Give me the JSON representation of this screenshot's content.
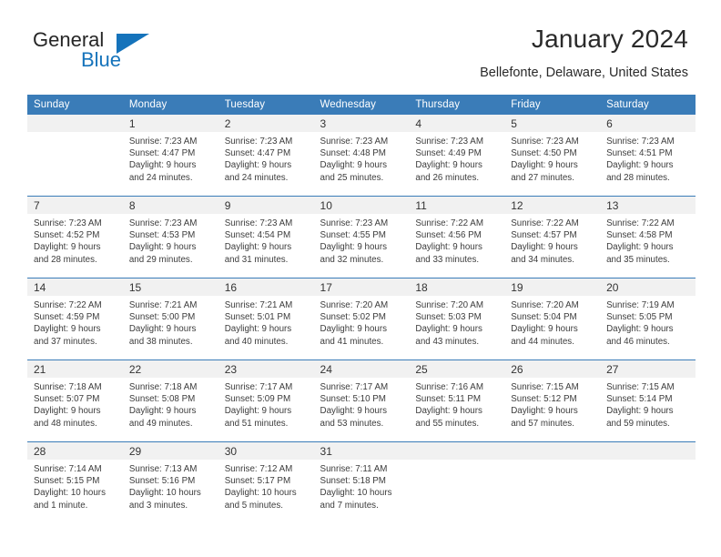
{
  "branding": {
    "word_one": "General",
    "word_two": "Blue"
  },
  "header": {
    "title": "January 2024",
    "location": "Bellefonte, Delaware, United States"
  },
  "calendar": {
    "weekday_headers": [
      "Sunday",
      "Monday",
      "Tuesday",
      "Wednesday",
      "Thursday",
      "Friday",
      "Saturday"
    ],
    "accent_color": "#3a7cb8",
    "daynum_band_color": "#f1f1f1",
    "weeks": [
      [
        {
          "day": "",
          "lines": []
        },
        {
          "day": "1",
          "lines": [
            "Sunrise: 7:23 AM",
            "Sunset: 4:47 PM",
            "Daylight: 9 hours",
            "and 24 minutes."
          ]
        },
        {
          "day": "2",
          "lines": [
            "Sunrise: 7:23 AM",
            "Sunset: 4:47 PM",
            "Daylight: 9 hours",
            "and 24 minutes."
          ]
        },
        {
          "day": "3",
          "lines": [
            "Sunrise: 7:23 AM",
            "Sunset: 4:48 PM",
            "Daylight: 9 hours",
            "and 25 minutes."
          ]
        },
        {
          "day": "4",
          "lines": [
            "Sunrise: 7:23 AM",
            "Sunset: 4:49 PM",
            "Daylight: 9 hours",
            "and 26 minutes."
          ]
        },
        {
          "day": "5",
          "lines": [
            "Sunrise: 7:23 AM",
            "Sunset: 4:50 PM",
            "Daylight: 9 hours",
            "and 27 minutes."
          ]
        },
        {
          "day": "6",
          "lines": [
            "Sunrise: 7:23 AM",
            "Sunset: 4:51 PM",
            "Daylight: 9 hours",
            "and 28 minutes."
          ]
        }
      ],
      [
        {
          "day": "7",
          "lines": [
            "Sunrise: 7:23 AM",
            "Sunset: 4:52 PM",
            "Daylight: 9 hours",
            "and 28 minutes."
          ]
        },
        {
          "day": "8",
          "lines": [
            "Sunrise: 7:23 AM",
            "Sunset: 4:53 PM",
            "Daylight: 9 hours",
            "and 29 minutes."
          ]
        },
        {
          "day": "9",
          "lines": [
            "Sunrise: 7:23 AM",
            "Sunset: 4:54 PM",
            "Daylight: 9 hours",
            "and 31 minutes."
          ]
        },
        {
          "day": "10",
          "lines": [
            "Sunrise: 7:23 AM",
            "Sunset: 4:55 PM",
            "Daylight: 9 hours",
            "and 32 minutes."
          ]
        },
        {
          "day": "11",
          "lines": [
            "Sunrise: 7:22 AM",
            "Sunset: 4:56 PM",
            "Daylight: 9 hours",
            "and 33 minutes."
          ]
        },
        {
          "day": "12",
          "lines": [
            "Sunrise: 7:22 AM",
            "Sunset: 4:57 PM",
            "Daylight: 9 hours",
            "and 34 minutes."
          ]
        },
        {
          "day": "13",
          "lines": [
            "Sunrise: 7:22 AM",
            "Sunset: 4:58 PM",
            "Daylight: 9 hours",
            "and 35 minutes."
          ]
        }
      ],
      [
        {
          "day": "14",
          "lines": [
            "Sunrise: 7:22 AM",
            "Sunset: 4:59 PM",
            "Daylight: 9 hours",
            "and 37 minutes."
          ]
        },
        {
          "day": "15",
          "lines": [
            "Sunrise: 7:21 AM",
            "Sunset: 5:00 PM",
            "Daylight: 9 hours",
            "and 38 minutes."
          ]
        },
        {
          "day": "16",
          "lines": [
            "Sunrise: 7:21 AM",
            "Sunset: 5:01 PM",
            "Daylight: 9 hours",
            "and 40 minutes."
          ]
        },
        {
          "day": "17",
          "lines": [
            "Sunrise: 7:20 AM",
            "Sunset: 5:02 PM",
            "Daylight: 9 hours",
            "and 41 minutes."
          ]
        },
        {
          "day": "18",
          "lines": [
            "Sunrise: 7:20 AM",
            "Sunset: 5:03 PM",
            "Daylight: 9 hours",
            "and 43 minutes."
          ]
        },
        {
          "day": "19",
          "lines": [
            "Sunrise: 7:20 AM",
            "Sunset: 5:04 PM",
            "Daylight: 9 hours",
            "and 44 minutes."
          ]
        },
        {
          "day": "20",
          "lines": [
            "Sunrise: 7:19 AM",
            "Sunset: 5:05 PM",
            "Daylight: 9 hours",
            "and 46 minutes."
          ]
        }
      ],
      [
        {
          "day": "21",
          "lines": [
            "Sunrise: 7:18 AM",
            "Sunset: 5:07 PM",
            "Daylight: 9 hours",
            "and 48 minutes."
          ]
        },
        {
          "day": "22",
          "lines": [
            "Sunrise: 7:18 AM",
            "Sunset: 5:08 PM",
            "Daylight: 9 hours",
            "and 49 minutes."
          ]
        },
        {
          "day": "23",
          "lines": [
            "Sunrise: 7:17 AM",
            "Sunset: 5:09 PM",
            "Daylight: 9 hours",
            "and 51 minutes."
          ]
        },
        {
          "day": "24",
          "lines": [
            "Sunrise: 7:17 AM",
            "Sunset: 5:10 PM",
            "Daylight: 9 hours",
            "and 53 minutes."
          ]
        },
        {
          "day": "25",
          "lines": [
            "Sunrise: 7:16 AM",
            "Sunset: 5:11 PM",
            "Daylight: 9 hours",
            "and 55 minutes."
          ]
        },
        {
          "day": "26",
          "lines": [
            "Sunrise: 7:15 AM",
            "Sunset: 5:12 PM",
            "Daylight: 9 hours",
            "and 57 minutes."
          ]
        },
        {
          "day": "27",
          "lines": [
            "Sunrise: 7:15 AM",
            "Sunset: 5:14 PM",
            "Daylight: 9 hours",
            "and 59 minutes."
          ]
        }
      ],
      [
        {
          "day": "28",
          "lines": [
            "Sunrise: 7:14 AM",
            "Sunset: 5:15 PM",
            "Daylight: 10 hours",
            "and 1 minute."
          ]
        },
        {
          "day": "29",
          "lines": [
            "Sunrise: 7:13 AM",
            "Sunset: 5:16 PM",
            "Daylight: 10 hours",
            "and 3 minutes."
          ]
        },
        {
          "day": "30",
          "lines": [
            "Sunrise: 7:12 AM",
            "Sunset: 5:17 PM",
            "Daylight: 10 hours",
            "and 5 minutes."
          ]
        },
        {
          "day": "31",
          "lines": [
            "Sunrise: 7:11 AM",
            "Sunset: 5:18 PM",
            "Daylight: 10 hours",
            "and 7 minutes."
          ]
        },
        {
          "day": "",
          "lines": []
        },
        {
          "day": "",
          "lines": []
        },
        {
          "day": "",
          "lines": []
        }
      ]
    ]
  }
}
